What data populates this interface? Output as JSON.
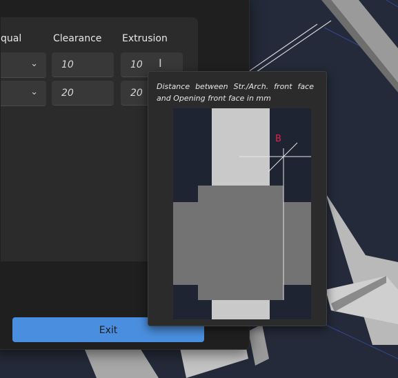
{
  "table": {
    "headers": {
      "partial": "qual",
      "clearance": "Clearance",
      "extrusion": "Extrusion"
    },
    "rows": [
      {
        "clearance": "10",
        "extrusion": "10"
      },
      {
        "clearance": "20",
        "extrusion": "20"
      }
    ]
  },
  "buttons": {
    "exit": "Exit"
  },
  "tooltip": {
    "text": "Distance between Str./Arch. front face and Opening front face in mm",
    "marker": "B"
  },
  "colors": {
    "accent": "#4a8fdf",
    "marker": "#e0244b",
    "panel": "#2b2b2b",
    "background": "#252b3a"
  },
  "icons": {
    "dropdown": "chevron-down-icon",
    "cursor": "text-cursor-icon"
  }
}
